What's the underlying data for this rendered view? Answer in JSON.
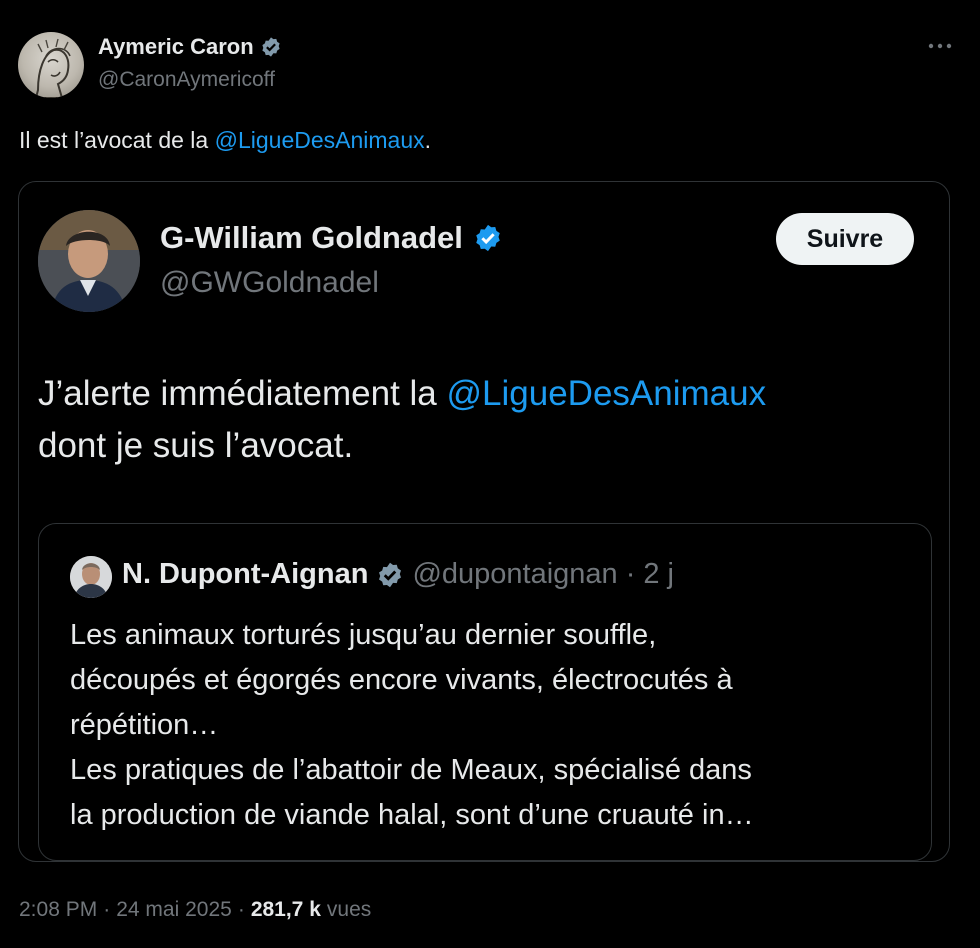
{
  "author": {
    "name": "Aymeric Caron",
    "handle": "@CaronAymericoff",
    "avatar_icon": "avatar-sketch-portrait",
    "verified_icon": "verified-badge-icon"
  },
  "tweet": {
    "text_before": "Il est l’avocat de la ",
    "mention": "@LigueDesAnimaux",
    "text_after": "."
  },
  "more_icon": "more-options-icon",
  "quoted": {
    "name": "G-William Goldnadel",
    "handle": "@GWGoldnadel",
    "follow_label": "Suivre",
    "text_line1_before": "J’alerte immédiatement la ",
    "mention": "@LigueDesAnimaux",
    "text_line2": "dont je suis l’avocat."
  },
  "nested": {
    "name": "N. Dupont-Aignan",
    "handle": "@dupontaignan",
    "dot": "·",
    "time": "2 j",
    "line1": "Les animaux torturés jusqu’au dernier souffle,",
    "line2": "découpés et égorgés encore vivants, électrocutés à",
    "line3": "répétition…",
    "line4": "Les pratiques de l’abattoir de Meaux, spécialisé dans",
    "line5": "la production de viande halal, sont d’une cruauté in…"
  },
  "footer": {
    "time": "2:08 PM",
    "sep1": "·",
    "date": "24 mai 2025",
    "sep2": "·",
    "views_count": "281,7 k",
    "views_label": "vues"
  },
  "colors": {
    "background": "#000000",
    "text": "#e7e9ea",
    "muted": "#71767b",
    "link": "#1d9bf0",
    "border": "#2f3336",
    "verified_blue": "#1d9bf0",
    "verified_gray": "#829aab"
  }
}
